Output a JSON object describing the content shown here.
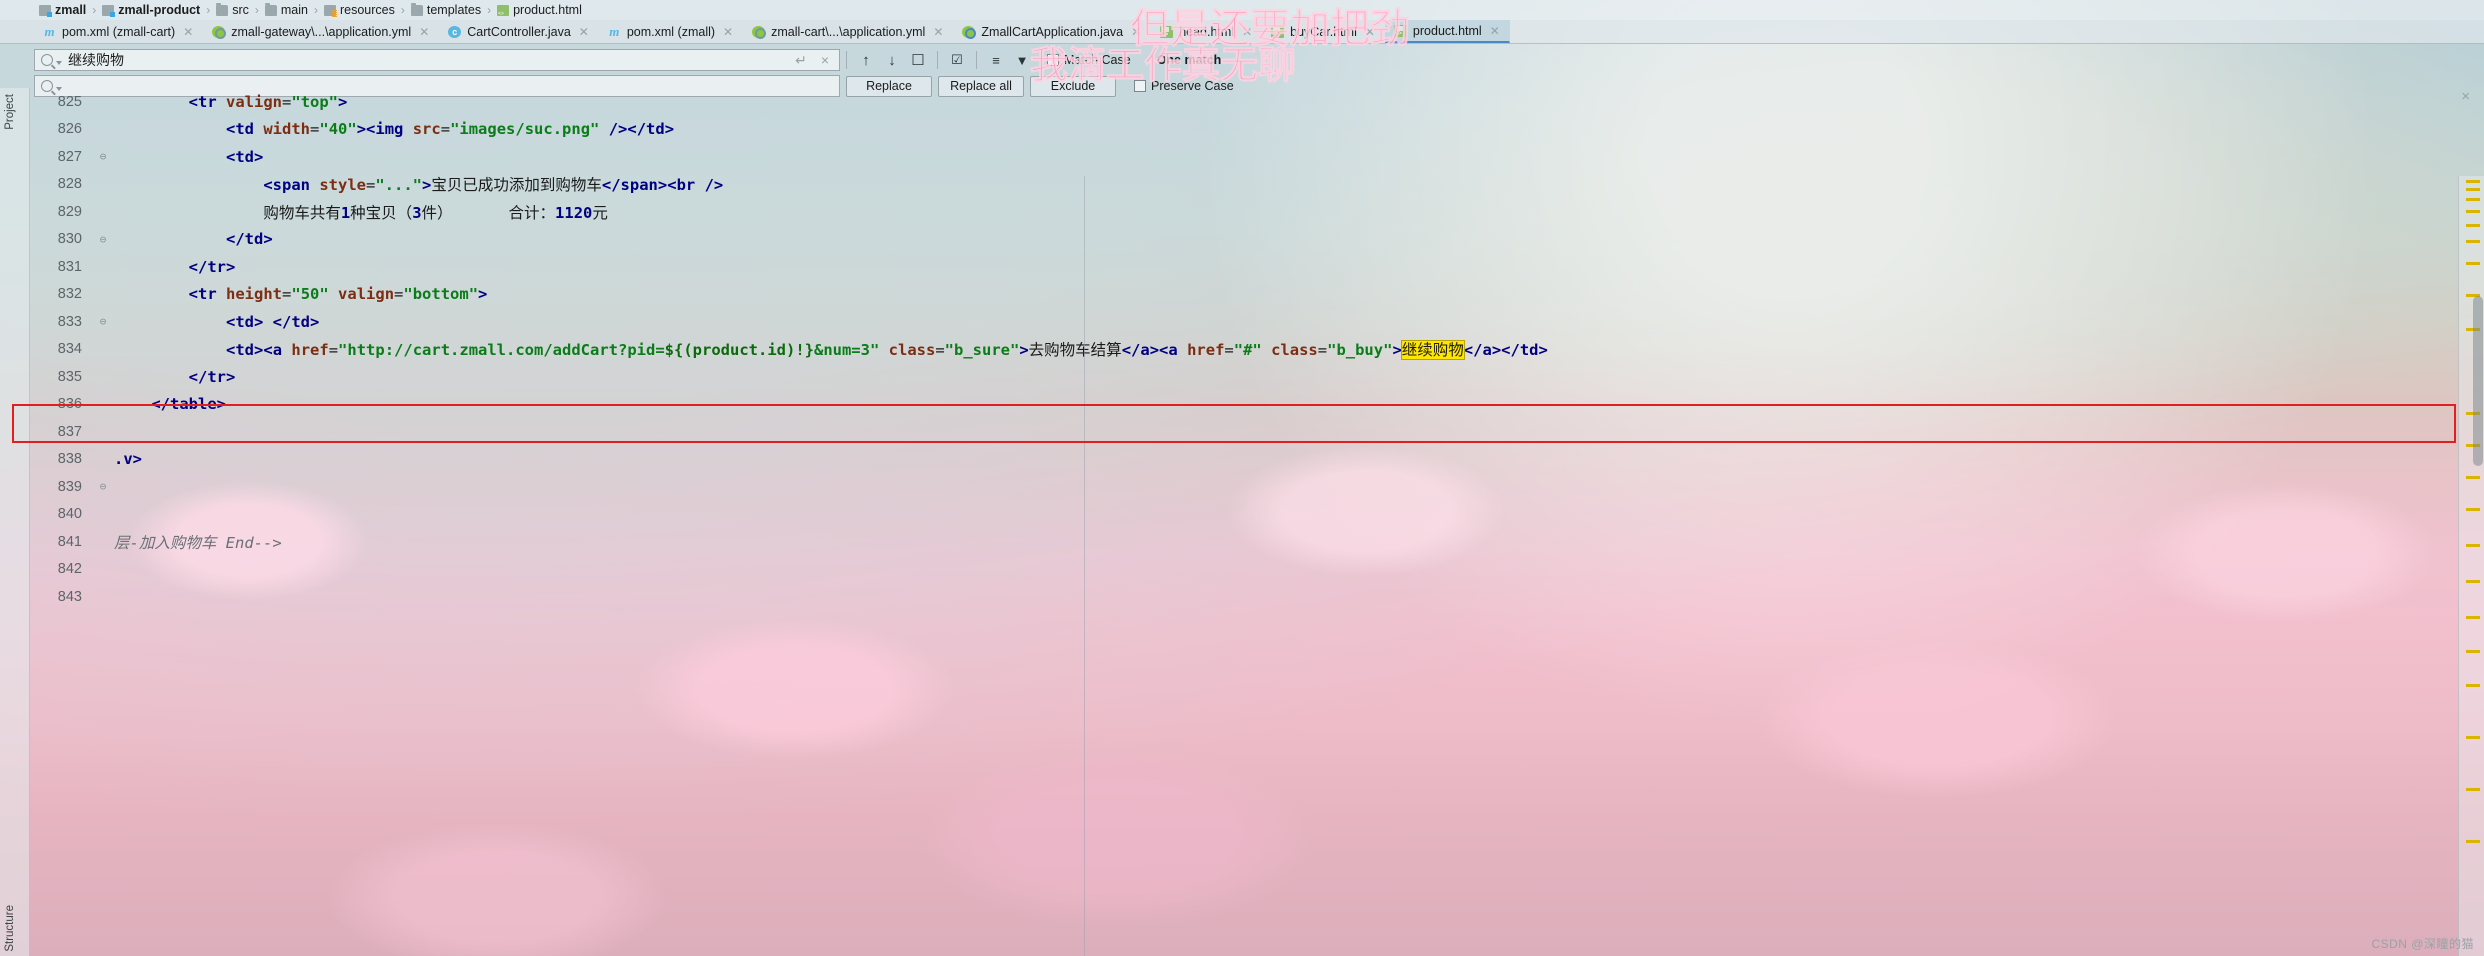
{
  "breadcrumb": [
    {
      "label": "zmall",
      "icon": "module-icon",
      "bold": true
    },
    {
      "label": "zmall-product",
      "icon": "module-icon",
      "bold": true
    },
    {
      "label": "src",
      "icon": "folder-icon",
      "bold": false
    },
    {
      "label": "main",
      "icon": "folder-icon",
      "bold": false
    },
    {
      "label": "resources",
      "icon": "resources-folder-icon",
      "bold": false
    },
    {
      "label": "templates",
      "icon": "folder-icon",
      "bold": false
    },
    {
      "label": "product.html",
      "icon": "html-file-icon",
      "bold": false
    }
  ],
  "tabs": [
    {
      "label": "pom.xml (zmall-cart)",
      "icon": "maven-icon",
      "active": false
    },
    {
      "label": "zmall-gateway\\...\\application.yml",
      "icon": "yml-icon",
      "active": false
    },
    {
      "label": "CartController.java",
      "icon": "java-class-icon",
      "active": false
    },
    {
      "label": "pom.xml (zmall)",
      "icon": "maven-icon",
      "active": false
    },
    {
      "label": "zmall-cart\\...\\application.yml",
      "icon": "yml-icon",
      "active": false
    },
    {
      "label": "ZmallCartApplication.java",
      "icon": "spring-boot-icon",
      "active": false
    },
    {
      "label": "head.html",
      "icon": "html-file-icon",
      "active": false
    },
    {
      "label": "buyCar.html",
      "icon": "html-file-icon",
      "active": false
    },
    {
      "label": "product.html",
      "icon": "html-file-icon",
      "active": true
    }
  ],
  "find": {
    "search_value": "继续购物",
    "search_placeholder": "",
    "replace_value": "",
    "replace_placeholder": "",
    "match_count": "One match",
    "buttons": {
      "replace": "Replace",
      "replace_all": "Replace all",
      "exclude": "Exclude"
    },
    "options": [
      {
        "label": "Match Case",
        "checked": false
      },
      {
        "label": "Preserve Case",
        "checked": false
      }
    ],
    "toolbar_icons": [
      "find-previous-icon",
      "find-next-icon",
      "select-all-occurrences-icon",
      "in-selection-icon",
      "filter-lines-icon",
      "filter-icon"
    ],
    "close_label": "×",
    "reset_label": "↵"
  },
  "editor": {
    "side_labels": [
      "Project",
      "Structure"
    ],
    "lines": [
      {
        "no": "825",
        "fold": "",
        "indent": 2,
        "segments": [
          {
            "t": "<",
            "c": "tag"
          },
          {
            "t": "tr",
            "c": "tag"
          },
          {
            "t": " ",
            "c": "txt"
          },
          {
            "t": "valign",
            "c": "attr"
          },
          {
            "t": "=",
            "c": "txt"
          },
          {
            "t": "\"top\"",
            "c": "str"
          },
          {
            "t": ">",
            "c": "tag"
          }
        ]
      },
      {
        "no": "826",
        "fold": "",
        "indent": 3,
        "segments": [
          {
            "t": "<",
            "c": "tag"
          },
          {
            "t": "td",
            "c": "tag"
          },
          {
            "t": " ",
            "c": "txt"
          },
          {
            "t": "width",
            "c": "attr"
          },
          {
            "t": "=",
            "c": "txt"
          },
          {
            "t": "\"40\"",
            "c": "str"
          },
          {
            "t": ">",
            "c": "tag"
          },
          {
            "t": "<",
            "c": "tag"
          },
          {
            "t": "img",
            "c": "tag"
          },
          {
            "t": " ",
            "c": "txt"
          },
          {
            "t": "src",
            "c": "attr"
          },
          {
            "t": "=",
            "c": "txt"
          },
          {
            "t": "\"images/suc.png\"",
            "c": "str"
          },
          {
            "t": " />",
            "c": "tag"
          },
          {
            "t": "</",
            "c": "tag"
          },
          {
            "t": "td",
            "c": "tag"
          },
          {
            "t": ">",
            "c": "tag"
          }
        ]
      },
      {
        "no": "827",
        "fold": "fold",
        "indent": 3,
        "segments": [
          {
            "t": "<",
            "c": "tag"
          },
          {
            "t": "td",
            "c": "tag"
          },
          {
            "t": ">",
            "c": "tag"
          }
        ]
      },
      {
        "no": "828",
        "fold": "",
        "indent": 4,
        "segments": [
          {
            "t": "<",
            "c": "tag"
          },
          {
            "t": "span",
            "c": "tag"
          },
          {
            "t": " ",
            "c": "txt"
          },
          {
            "t": "style",
            "c": "attr"
          },
          {
            "t": "=",
            "c": "txt"
          },
          {
            "t": "\"...\"",
            "c": "str"
          },
          {
            "t": ">",
            "c": "tag"
          },
          {
            "t": "宝贝已成功添加到购物车",
            "c": "txt"
          },
          {
            "t": "</",
            "c": "tag"
          },
          {
            "t": "span",
            "c": "tag"
          },
          {
            "t": ">",
            "c": "tag"
          },
          {
            "t": "<",
            "c": "tag"
          },
          {
            "t": "br",
            "c": "tag"
          },
          {
            "t": " />",
            "c": "tag"
          }
        ]
      },
      {
        "no": "829",
        "fold": "",
        "indent": 4,
        "segments": [
          {
            "t": "购物车共有",
            "c": "txt"
          },
          {
            "t": "1",
            "c": "num"
          },
          {
            "t": "种宝贝（",
            "c": "txt"
          },
          {
            "t": "3",
            "c": "num"
          },
          {
            "t": "件）",
            "c": "txt"
          },
          {
            "t": "      合计：",
            "c": "txt"
          },
          {
            "t": "1120",
            "c": "num"
          },
          {
            "t": "元",
            "c": "txt"
          }
        ]
      },
      {
        "no": "830",
        "fold": "fold",
        "indent": 3,
        "segments": [
          {
            "t": "</",
            "c": "tag"
          },
          {
            "t": "td",
            "c": "tag"
          },
          {
            "t": ">",
            "c": "tag"
          }
        ]
      },
      {
        "no": "831",
        "fold": "",
        "indent": 2,
        "segments": [
          {
            "t": "</",
            "c": "tag"
          },
          {
            "t": "tr",
            "c": "tag"
          },
          {
            "t": ">",
            "c": "tag"
          }
        ]
      },
      {
        "no": "832",
        "fold": "",
        "indent": 2,
        "segments": [
          {
            "t": "<",
            "c": "tag"
          },
          {
            "t": "tr",
            "c": "tag"
          },
          {
            "t": " ",
            "c": "txt"
          },
          {
            "t": "height",
            "c": "attr"
          },
          {
            "t": "=",
            "c": "txt"
          },
          {
            "t": "\"50\"",
            "c": "str"
          },
          {
            "t": " ",
            "c": "txt"
          },
          {
            "t": "valign",
            "c": "attr"
          },
          {
            "t": "=",
            "c": "txt"
          },
          {
            "t": "\"bottom\"",
            "c": "str"
          },
          {
            "t": ">",
            "c": "tag"
          }
        ]
      },
      {
        "no": "833",
        "fold": "fold",
        "indent": 3,
        "segments": [
          {
            "t": "<",
            "c": "tag"
          },
          {
            "t": "td",
            "c": "tag"
          },
          {
            "t": "> ",
            "c": "tag"
          },
          {
            "t": "</",
            "c": "tag"
          },
          {
            "t": "td",
            "c": "tag"
          },
          {
            "t": ">",
            "c": "tag"
          }
        ]
      },
      {
        "no": "834",
        "fold": "",
        "indent": 3,
        "boxed": true,
        "segments": [
          {
            "t": "<",
            "c": "tag"
          },
          {
            "t": "td",
            "c": "tag"
          },
          {
            "t": ">",
            "c": "tag"
          },
          {
            "t": "<",
            "c": "tag"
          },
          {
            "t": "a",
            "c": "tag"
          },
          {
            "t": " ",
            "c": "txt"
          },
          {
            "t": "href",
            "c": "attr"
          },
          {
            "t": "=",
            "c": "txt"
          },
          {
            "t": "\"http://cart.zmall.com/addCart?pid=",
            "c": "str"
          },
          {
            "t": "${(product.id)!}",
            "c": "el"
          },
          {
            "t": "&num=3\"",
            "c": "str"
          },
          {
            "t": " ",
            "c": "txt"
          },
          {
            "t": "class",
            "c": "attr"
          },
          {
            "t": "=",
            "c": "txt"
          },
          {
            "t": "\"b_sure\"",
            "c": "str"
          },
          {
            "t": ">",
            "c": "tag"
          },
          {
            "t": "去购物车结算",
            "c": "txt"
          },
          {
            "t": "</",
            "c": "tag"
          },
          {
            "t": "a",
            "c": "tag"
          },
          {
            "t": ">",
            "c": "tag"
          },
          {
            "t": "<",
            "c": "tag"
          },
          {
            "t": "a",
            "c": "tag"
          },
          {
            "t": " ",
            "c": "txt"
          },
          {
            "t": "href",
            "c": "attr"
          },
          {
            "t": "=",
            "c": "txt"
          },
          {
            "t": "\"#\"",
            "c": "str"
          },
          {
            "t": " ",
            "c": "txt"
          },
          {
            "t": "class",
            "c": "attr"
          },
          {
            "t": "=",
            "c": "txt"
          },
          {
            "t": "\"b_buy\"",
            "c": "str"
          },
          {
            "t": ">",
            "c": "tag"
          },
          {
            "t": "继续购物",
            "c": "hl"
          },
          {
            "t": "</",
            "c": "tag"
          },
          {
            "t": "a",
            "c": "tag"
          },
          {
            "t": ">",
            "c": "tag"
          },
          {
            "t": "</",
            "c": "tag"
          },
          {
            "t": "td",
            "c": "tag"
          },
          {
            "t": ">",
            "c": "tag"
          }
        ]
      },
      {
        "no": "835",
        "fold": "",
        "indent": 2,
        "segments": [
          {
            "t": "</",
            "c": "tag"
          },
          {
            "t": "tr",
            "c": "tag"
          },
          {
            "t": ">",
            "c": "tag"
          }
        ]
      },
      {
        "no": "836",
        "fold": "",
        "indent": 1,
        "segments": [
          {
            "t": "</",
            "c": "tag"
          },
          {
            "t": "table",
            "c": "tag"
          },
          {
            "t": ">",
            "c": "tag"
          }
        ]
      },
      {
        "no": "837",
        "fold": "",
        "indent": 0,
        "segments": []
      },
      {
        "no": "838",
        "fold": "",
        "indent": 0,
        "segments": [
          {
            "t": ".v>",
            "c": "tag"
          }
        ]
      },
      {
        "no": "839",
        "fold": "fold",
        "indent": 0,
        "segments": []
      },
      {
        "no": "840",
        "fold": "",
        "indent": 0,
        "segments": []
      },
      {
        "no": "841",
        "fold": "",
        "indent": 0,
        "segments": [
          {
            "t": "层-加入购物车 End-->",
            "c": "cmt"
          }
        ]
      },
      {
        "no": "842",
        "fold": "",
        "indent": 0,
        "segments": []
      },
      {
        "no": "843",
        "fold": "",
        "indent": 0,
        "segments": []
      }
    ]
  },
  "watermarks": [
    {
      "text": "但是还要加把劲",
      "name": "watermark-top"
    },
    {
      "text": "我滴工作真无聊",
      "name": "watermark-second"
    }
  ],
  "footer": {
    "credit": "CSDN @深瞳的猫"
  },
  "colors": {
    "accent": "#4a89c8",
    "match_highlight": "#ffe600",
    "red_box": "#e02020",
    "watermark_pink": "#ff8fb4"
  }
}
